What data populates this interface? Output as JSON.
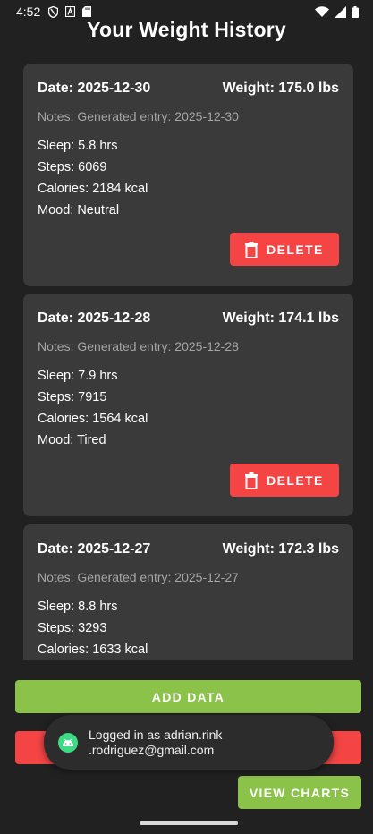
{
  "status_bar": {
    "time": "4:52"
  },
  "page": {
    "title": "Your Weight History"
  },
  "entries": [
    {
      "date": "Date: 2025-12-30",
      "weight": "Weight: 175.0 lbs",
      "notes": "Notes: Generated entry: 2025-12-30",
      "sleep": "Sleep: 5.8 hrs",
      "steps": "Steps: 6069",
      "calories": "Calories: 2184 kcal",
      "mood": "Mood: Neutral",
      "delete_label": "DELETE"
    },
    {
      "date": "Date: 2025-12-28",
      "weight": "Weight: 174.1 lbs",
      "notes": "Notes: Generated entry: 2025-12-28",
      "sleep": "Sleep: 7.9 hrs",
      "steps": "Steps: 7915",
      "calories": "Calories: 1564 kcal",
      "mood": "Mood: Tired",
      "delete_label": "DELETE"
    },
    {
      "date": "Date: 2025-12-27",
      "weight": "Weight: 172.3 lbs",
      "notes": "Notes: Generated entry: 2025-12-27",
      "sleep": "Sleep: 8.8 hrs",
      "steps": "Steps: 3293",
      "calories": "Calories: 1633 kcal",
      "mood": "",
      "delete_label": "DELETE"
    }
  ],
  "actions": {
    "add_data_label": "ADD DATA",
    "view_charts_label": "VIEW CHARTS"
  },
  "toast": {
    "line1": "Logged in as adrian.rink",
    "line2": ".rodriguez@gmail.com"
  },
  "colors": {
    "background": "#212121",
    "card": "#3a3a3a",
    "accent_green": "#8bc34a",
    "danger_red": "#f44444"
  }
}
